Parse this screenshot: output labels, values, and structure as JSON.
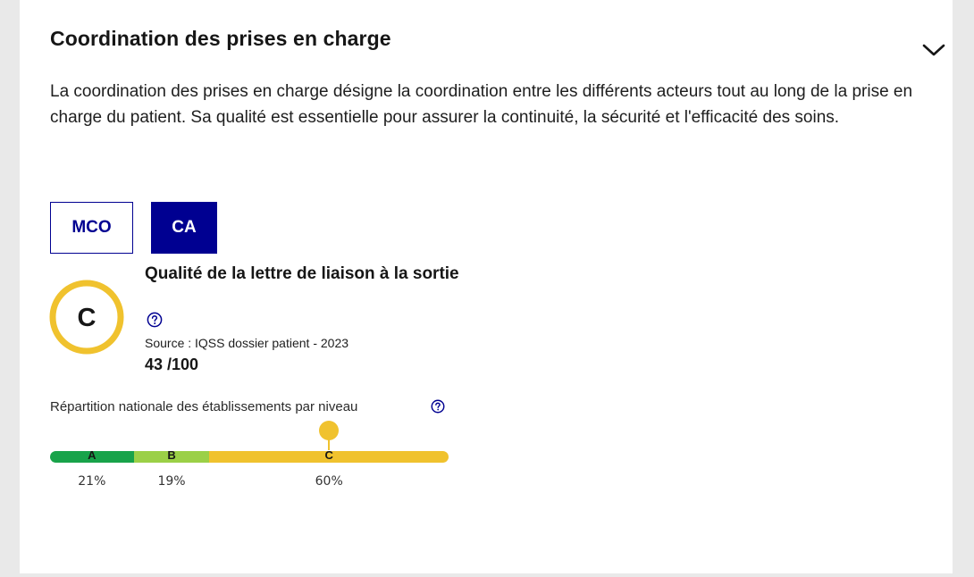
{
  "section": {
    "title": "Coordination des prises en charge",
    "description": "La coordination des prises en charge désigne la coordination entre les différents acteurs tout au long de la prise en charge du patient. Sa qualité est essentielle pour assurer la continuité, la sécurité et l'ef­ficacité des soins."
  },
  "tabs": [
    {
      "label": "MCO",
      "selected": false
    },
    {
      "label": "CA",
      "selected": true
    }
  ],
  "indicator": {
    "grade": "C",
    "grade_color": "#f0c22e",
    "title": "Qualité de la lettre de liaison à la sortie",
    "source": "Source : IQSS dossier patient - 2023",
    "score": "43 /100"
  },
  "distribution": {
    "label": "Répartition nationale des établissements par niveau",
    "current_level": "C",
    "levels": [
      {
        "letter": "A",
        "percent": 21,
        "percent_label": "21%",
        "color": "#18a34a"
      },
      {
        "letter": "B",
        "percent": 19,
        "percent_label": "19%",
        "color": "#9bd047"
      },
      {
        "letter": "C",
        "percent": 60,
        "percent_label": "60%",
        "color": "#f0c22e"
      }
    ]
  },
  "icons": {
    "toggle": "chevron-down-icon",
    "help": "question-circle-icon",
    "marker": "location-pin-icon"
  },
  "colors": {
    "primary": "#000091",
    "accent": "#f0c22e"
  }
}
